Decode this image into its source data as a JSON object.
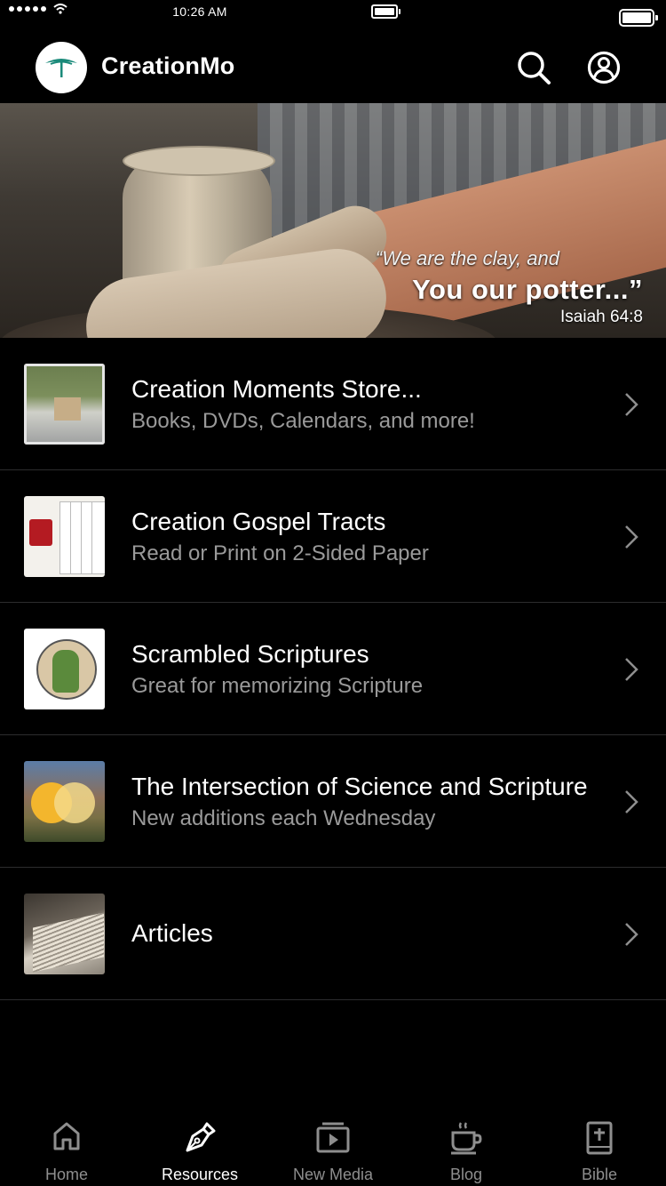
{
  "status_bar": {
    "time": "10:26 AM"
  },
  "header": {
    "title": "CreationMo"
  },
  "hero": {
    "quote_line1": "“We are the clay, and",
    "quote_line2": "You our potter...”",
    "reference": "Isaiah 64:8"
  },
  "resources": [
    {
      "title": "Creation Moments Store...",
      "subtitle": "Books, DVDs, Calendars, and more!",
      "thumbnail": "store-thumbnail"
    },
    {
      "title": "Creation Gospel Tracts",
      "subtitle": "Read or Print on 2-Sided Paper",
      "thumbnail": "tracts-thumbnail"
    },
    {
      "title": "Scrambled Scriptures",
      "subtitle": "Great for memorizing Scripture",
      "thumbnail": "scrambled-thumbnail"
    },
    {
      "title": "The Intersection of Science and Scripture",
      "subtitle": "New additions each Wednesday",
      "thumbnail": "intersection-thumbnail"
    },
    {
      "title": "Articles",
      "subtitle": "",
      "thumbnail": "articles-thumbnail"
    }
  ],
  "tabs": [
    {
      "label": "Home",
      "icon": "home-icon",
      "active": false
    },
    {
      "label": "Resources",
      "icon": "pen-nib-icon",
      "active": true
    },
    {
      "label": "New Media",
      "icon": "media-play-icon",
      "active": false
    },
    {
      "label": "Blog",
      "icon": "coffee-cup-icon",
      "active": false
    },
    {
      "label": "Bible",
      "icon": "bible-icon",
      "active": false
    }
  ],
  "colors": {
    "background": "#000000",
    "text": "#ffffff",
    "subtitle": "#9a9a9a",
    "tab_inactive": "#8e8e8e",
    "divider": "#2c2c2e"
  }
}
